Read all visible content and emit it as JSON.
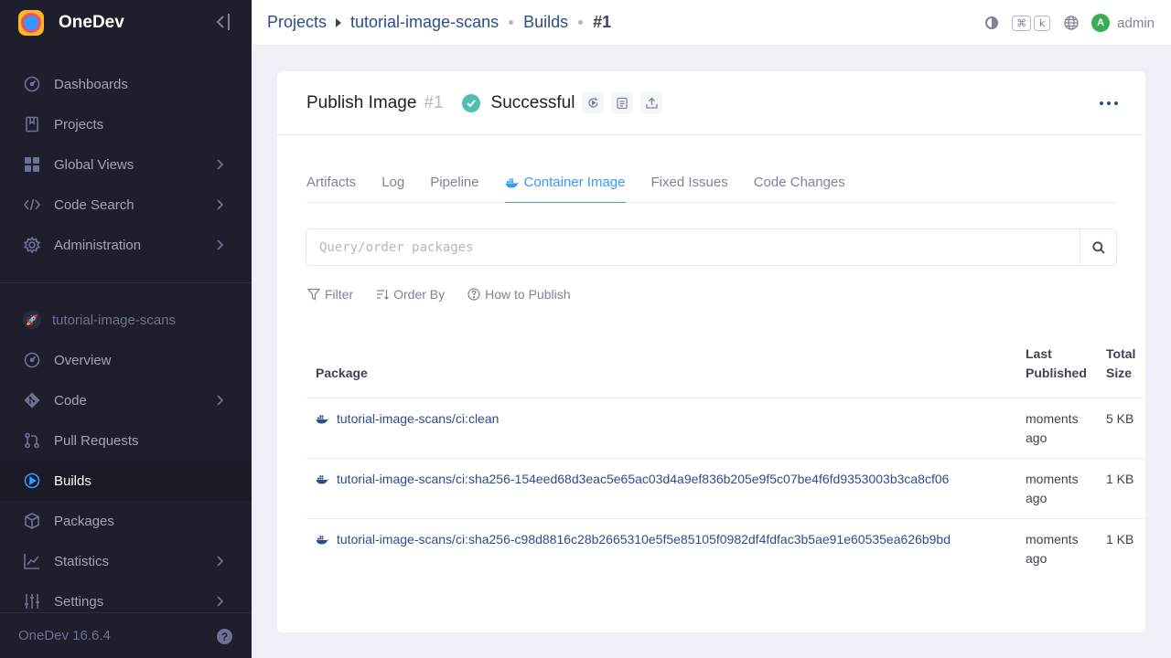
{
  "app": {
    "name": "OneDev",
    "version": "OneDev 16.6.4"
  },
  "sidebar": {
    "top_items": [
      {
        "label": "Dashboards",
        "icon": "dashboard-icon",
        "has_children": false
      },
      {
        "label": "Projects",
        "icon": "book-icon",
        "has_children": false
      },
      {
        "label": "Global Views",
        "icon": "grid-icon",
        "has_children": true
      },
      {
        "label": "Code Search",
        "icon": "code-icon",
        "has_children": true
      },
      {
        "label": "Administration",
        "icon": "gear-icon",
        "has_children": true
      }
    ],
    "project_name": "tutorial-image-scans",
    "project_items": [
      {
        "label": "Overview",
        "icon": "dashboard-icon",
        "has_children": false
      },
      {
        "label": "Code",
        "icon": "git-icon",
        "has_children": true
      },
      {
        "label": "Pull Requests",
        "icon": "pull-request-icon",
        "has_children": false
      },
      {
        "label": "Builds",
        "icon": "play-icon",
        "has_children": false,
        "active": true
      },
      {
        "label": "Packages",
        "icon": "package-icon",
        "has_children": false
      },
      {
        "label": "Statistics",
        "icon": "chart-icon",
        "has_children": true
      },
      {
        "label": "Settings",
        "icon": "sliders-icon",
        "has_children": true
      }
    ]
  },
  "topbar": {
    "crumbs": [
      "Projects",
      "tutorial-image-scans",
      "Builds",
      "#1"
    ],
    "kbd_cmd": "⌘",
    "kbd_key": "k",
    "avatar_letter": "A",
    "user_name": "admin"
  },
  "build": {
    "name": "Publish Image",
    "number": "#1",
    "status": "Successful",
    "status_color": "#4fbfb2"
  },
  "tabs": [
    {
      "label": "Artifacts"
    },
    {
      "label": "Log"
    },
    {
      "label": "Pipeline"
    },
    {
      "label": "Container Image",
      "active": true
    },
    {
      "label": "Fixed Issues"
    },
    {
      "label": "Code Changes"
    }
  ],
  "search": {
    "placeholder": "Query/order packages"
  },
  "toolbar": {
    "filter": "Filter",
    "order_by": "Order By",
    "how_to_publish": "How to Publish"
  },
  "table": {
    "headers": {
      "package": "Package",
      "last_published_1": "Last",
      "last_published_2": "Published",
      "total_size_1": "Total",
      "total_size_2": "Size"
    },
    "rows": [
      {
        "package": "tutorial-image-scans/ci:clean",
        "published_1": "moments",
        "published_2": "ago",
        "size": "5 KB"
      },
      {
        "package": "tutorial-image-scans/ci:sha256-154eed68d3eac5e65ac03d4a9ef836b205e9f5c07be4f6fd9353003b3ca8cf06",
        "published_1": "moments",
        "published_2": "ago",
        "size": "1 KB"
      },
      {
        "package": "tutorial-image-scans/ci:sha256-c98d8816c28b2665310e5f5e85105f0982df4fdfac3b5ae91e60535ea626b9bd",
        "published_1": "moments",
        "published_2": "ago",
        "size": "1 KB"
      }
    ]
  },
  "colors": {
    "accent": "#3699ff",
    "sidebar_bg": "#1e1e2d",
    "link": "#2c4c8a"
  }
}
